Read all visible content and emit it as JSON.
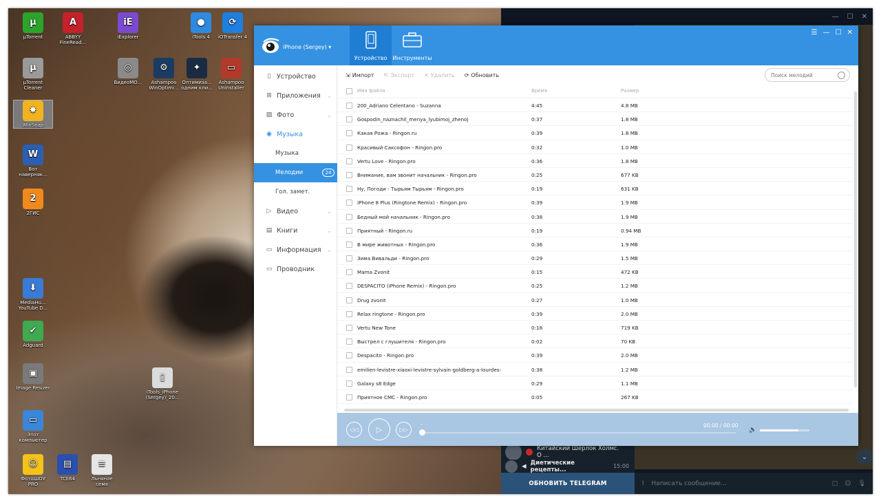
{
  "desktop": {
    "icons": [
      {
        "label": "µTorrent",
        "icon": "utorrent-icon",
        "color": "#2aa52a",
        "glyph": "µ"
      },
      {
        "label": "ABBYY\nFineRead...",
        "icon": "abbyy-icon",
        "color": "#c6202a",
        "glyph": "A"
      },
      {
        "label": "iExplorer",
        "icon": "iexplorer-icon",
        "color": "#7a4bd1",
        "glyph": "iE"
      },
      {
        "label": "iTools 4",
        "icon": "itools-icon",
        "color": "#2e8ae0",
        "glyph": "●"
      },
      {
        "label": "iOTransfer 4",
        "icon": "iotransfer-icon",
        "color": "#1d7fe0",
        "glyph": "⟳"
      },
      {
        "label": "µTorrent\nCleaner",
        "icon": "utorrent-cleaner-icon",
        "color": "#9a9a9a",
        "glyph": "µ"
      },
      {
        "label": "ВидеоМО...",
        "icon": "videomaster-icon",
        "color": "#8a8a8a",
        "glyph": "◎"
      },
      {
        "label": "Ashampoo\nWinOptimi...",
        "icon": "ashampoo-winoptimizer-icon",
        "color": "#1a3c63",
        "glyph": "⚙"
      },
      {
        "label": "Оптимиза...\nодним кли...",
        "icon": "optimizer-icon",
        "color": "#1a2c43",
        "glyph": "✦"
      },
      {
        "label": "Ashampoo\nUninstaller",
        "icon": "ashampoo-uninstaller-icon",
        "color": "#b23a2a",
        "glyph": "▭"
      },
      {
        "label": "WinSnap",
        "icon": "winsnap-icon",
        "color": "#f2b320",
        "glyph": "✸"
      },
      {
        "label": "Вот\nнаверняк...",
        "icon": "word-document-icon",
        "color": "#2b5fb4",
        "glyph": "W"
      },
      {
        "label": "2ГИС",
        "icon": "2gis-icon",
        "color": "#f08a1c",
        "glyph": "2"
      },
      {
        "label": "MediaHu...\nYouTube D...",
        "icon": "mediahuman-icon",
        "color": "#3a7bd5",
        "glyph": "⬇"
      },
      {
        "label": "Adguard",
        "icon": "adguard-icon",
        "color": "#3faa52",
        "glyph": "✔"
      },
      {
        "label": "Image Resizer",
        "icon": "image-resizer-icon",
        "color": "#7a7a7a",
        "glyph": "▣"
      },
      {
        "label": "Этот\nкомпьютер",
        "icon": "this-pc-icon",
        "color": "#3a86d8",
        "glyph": "▭"
      },
      {
        "label": "ФотоШОУ\nPRO",
        "icon": "fotoshow-icon",
        "color": "#f5c21a",
        "glyph": "☺"
      },
      {
        "label": "TCE64",
        "icon": "total-commander-icon",
        "color": "#2a4fb0",
        "glyph": "▤"
      },
      {
        "label": "Льняное\nсемя",
        "icon": "document-icon",
        "color": "#e6e6e6",
        "glyph": "≡"
      },
      {
        "label": "iTools_iPhone\n(Sergey)_20...",
        "icon": "archive-icon",
        "color": "#dcdcdc",
        "glyph": "▯"
      }
    ]
  },
  "telegram": {
    "chats": [
      {
        "title": "Китайский Шерлок Холмс. О ...",
        "time": ""
      },
      {
        "title": "Диетические рецепты...",
        "time": "15:00"
      }
    ],
    "update_button": "ОБНОВИТЬ TELEGRAM",
    "message_placeholder": "Написать сообщение..."
  },
  "itools": {
    "device_name": "iPhone (Sergey) ▾",
    "tabs": [
      {
        "label": "Устройство",
        "icon": "phone-icon"
      },
      {
        "label": "Инструменты",
        "icon": "toolbox-icon"
      }
    ],
    "sidebar": [
      {
        "label": "Устройство",
        "icon": "device-icon"
      },
      {
        "label": "Приложения",
        "icon": "apps-icon"
      },
      {
        "label": "Фото",
        "icon": "photo-icon"
      },
      {
        "label": "Музыка",
        "icon": "music-icon"
      },
      {
        "label": "Музыка"
      },
      {
        "label": "Мелодии",
        "badge": "24"
      },
      {
        "label": "Гол. замет."
      },
      {
        "label": "Видео",
        "icon": "video-icon"
      },
      {
        "label": "Книги",
        "icon": "book-icon"
      },
      {
        "label": "Информация",
        "icon": "info-icon"
      },
      {
        "label": "Проводник",
        "icon": "folder-icon"
      }
    ],
    "toolbar": {
      "import": "Импорт",
      "export": "Экспорт",
      "delete": "Удалить",
      "refresh": "Обновить",
      "search_placeholder": "Поиск мелодий"
    },
    "columns": {
      "name": "Имя файла",
      "time": "Время",
      "size": "Размер"
    },
    "rows": [
      {
        "name": "200_Adriano Celentano - Suzanna",
        "time": "4:45",
        "size": "4.8 MB"
      },
      {
        "name": "Gospodin_naznachil_menya_lyubimoj_zhenoj",
        "time": "0:37",
        "size": "1.8 MB"
      },
      {
        "name": "Какая Рожа - Ringon.ru",
        "time": "0:39",
        "size": "1.8 MB"
      },
      {
        "name": "Красивый Саксофон - Ringon.pro",
        "time": "0:32",
        "size": "1.0 MB"
      },
      {
        "name": "Vertu Love - Ringon.pro",
        "time": "0:36",
        "size": "1.8 MB"
      },
      {
        "name": "Внимание, вам звонит начальник - Ringon.pro",
        "time": "0:25",
        "size": "677 KB"
      },
      {
        "name": "Ну, Погоди - Тырьям Тырьям - Ringon.pro",
        "time": "0:19",
        "size": "631 KB"
      },
      {
        "name": "iPhone 8 Plus (Ringtone Remix) - Ringon.pro",
        "time": "0:39",
        "size": "1.9 MB"
      },
      {
        "name": "Бедный мой начальник - Ringon.pro",
        "time": "0:38",
        "size": "1.9 MB"
      },
      {
        "name": "Приятный - Ringon.ru",
        "time": "0:19",
        "size": "0.94 MB"
      },
      {
        "name": "В мире животных - Ringon.pro",
        "time": "0:36",
        "size": "1.9 MB"
      },
      {
        "name": "Зима Вивальди - Ringon.pro",
        "time": "0:29",
        "size": "1.5 MB"
      },
      {
        "name": "Mama Zvonit",
        "time": "0:15",
        "size": "472 KB"
      },
      {
        "name": "DESPACITO (iPhone Remix) - Ringon.pro",
        "time": "0:25",
        "size": "1.2 MB"
      },
      {
        "name": "Drug zvonit",
        "time": "0:27",
        "size": "1.0 MB"
      },
      {
        "name": "Relax ringtone - Ringon.pro",
        "time": "0:39",
        "size": "2.0 MB"
      },
      {
        "name": "Vertu New Tone",
        "time": "0:18",
        "size": "719 KB"
      },
      {
        "name": "Выстрел с глушителя - Ringon.pro",
        "time": "0:02",
        "size": "70 KB"
      },
      {
        "name": "Despacito - Ringon.pro",
        "time": "0:39",
        "size": "2.0 MB"
      },
      {
        "name": "emilien-levistre-xiaoxi-levistre-sylvain-goldberg-a-lourdes-",
        "time": "0:38",
        "size": "1.2 MB"
      },
      {
        "name": "Galaxy s8 Edge",
        "time": "0:29",
        "size": "1.1 MB"
      },
      {
        "name": "Приятное СМС - Ringon.pro",
        "time": "0:05",
        "size": "267 KB"
      }
    ],
    "player": {
      "time": "00:00 / 00:00",
      "mini": "--",
      "volume": 0.78
    }
  }
}
